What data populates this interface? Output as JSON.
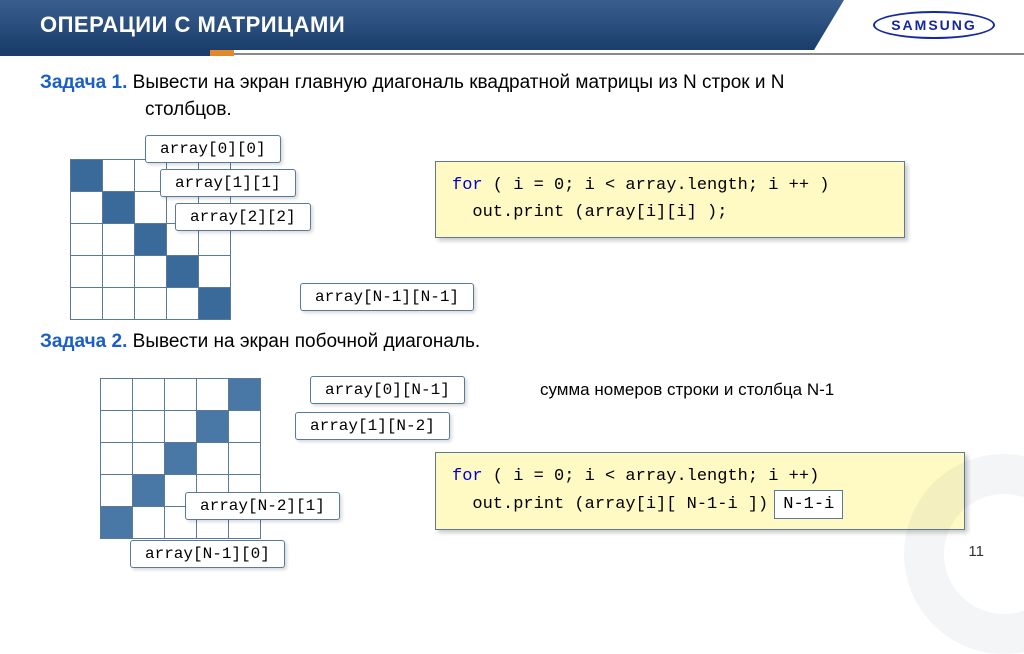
{
  "header": {
    "title": "ОПЕРАЦИИ С МАТРИЦАМИ"
  },
  "logo": "SAMSUNG",
  "task1": {
    "label": "Задача 1.",
    "text1": "Вывести на экран главную диагональ квадратной матрицы из N строк и N",
    "text2": "столбцов.",
    "labels": {
      "l00": "array[0][0]",
      "l11": "array[1][1]",
      "l22": "array[2][2]",
      "lNN": "array[N-1][N-1]"
    },
    "code": {
      "line1a": "for",
      "line1b": " ( i = 0;  i < array.length;  i ++ )",
      "line2": "  out.print (array[i][i] );"
    }
  },
  "task2": {
    "label": "Задача 2.",
    "text": "Вывести на экран побочной диагональ.",
    "labels": {
      "l0N1": "array[0][N-1]",
      "l1N2": "array[1][N-2]",
      "lN21": "array[N-2][1]",
      "lN10": "array[N-1][0]"
    },
    "note": "сумма номеров строки и столбца N-1",
    "code": {
      "line1a": "for",
      "line1b": " ( i = 0;  i < array.length;  i ++)",
      "line2": "  out.print (array[i][ N-1-i ])",
      "hl": "N-1-i"
    }
  },
  "page": "11"
}
